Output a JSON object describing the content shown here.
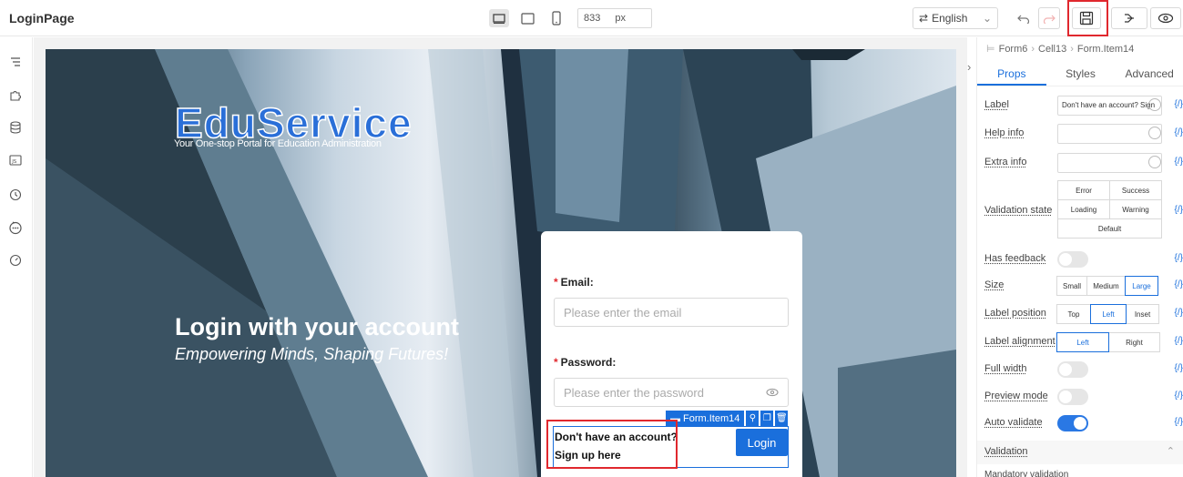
{
  "app": {
    "title": "LoginPage"
  },
  "toolbar": {
    "width_value": "833",
    "width_unit": "px",
    "language": "English"
  },
  "hero": {
    "logo": "EduService",
    "tagline": "Your One-stop Portal for Education Administration",
    "title": "Login with your account",
    "subtitle": "Empowering Minds, Shaping Futures!"
  },
  "form": {
    "email_label": "Email:",
    "email_placeholder": "Please enter the email",
    "password_label": "Password:",
    "password_placeholder": "Please enter the password",
    "required_mark": "*",
    "selected_item_tag": "Form.Item14",
    "signup_line1": "Don't have an account?",
    "signup_line2": "Sign up here",
    "login_button": "Login"
  },
  "panel": {
    "breadcrumb": [
      "Form6",
      "Cell13",
      "Form.Item14"
    ],
    "tabs": [
      "Props",
      "Styles",
      "Advanced"
    ],
    "active_tab": "Props",
    "code_token": "{/}",
    "props": {
      "label": {
        "name": "Label",
        "value": "Don't have an account? Sign"
      },
      "help_info": {
        "name": "Help info"
      },
      "extra_info": {
        "name": "Extra info"
      },
      "validation_state": {
        "name": "Validation state",
        "options": [
          "Error",
          "Success",
          "Loading",
          "Warning",
          "Default"
        ]
      },
      "has_feedback": {
        "name": "Has feedback",
        "on": false
      },
      "size": {
        "name": "Size",
        "options": [
          "Small",
          "Medium",
          "Large"
        ],
        "selected": "Large"
      },
      "label_position": {
        "name": "Label position",
        "options": [
          "Top",
          "Left",
          "Inset"
        ],
        "selected": "Left"
      },
      "label_alignment": {
        "name": "Label alignment",
        "options": [
          "Left",
          "Right"
        ],
        "selected": "Left"
      },
      "full_width": {
        "name": "Full width",
        "on": false
      },
      "preview_mode": {
        "name": "Preview mode",
        "on": false
      },
      "auto_validate": {
        "name": "Auto validate",
        "on": true
      }
    },
    "validation_section": "Validation",
    "mandatory_validation": "Mandatory validation"
  },
  "colors": {
    "accent": "#1a6fdc",
    "highlight": "#e0282e"
  }
}
